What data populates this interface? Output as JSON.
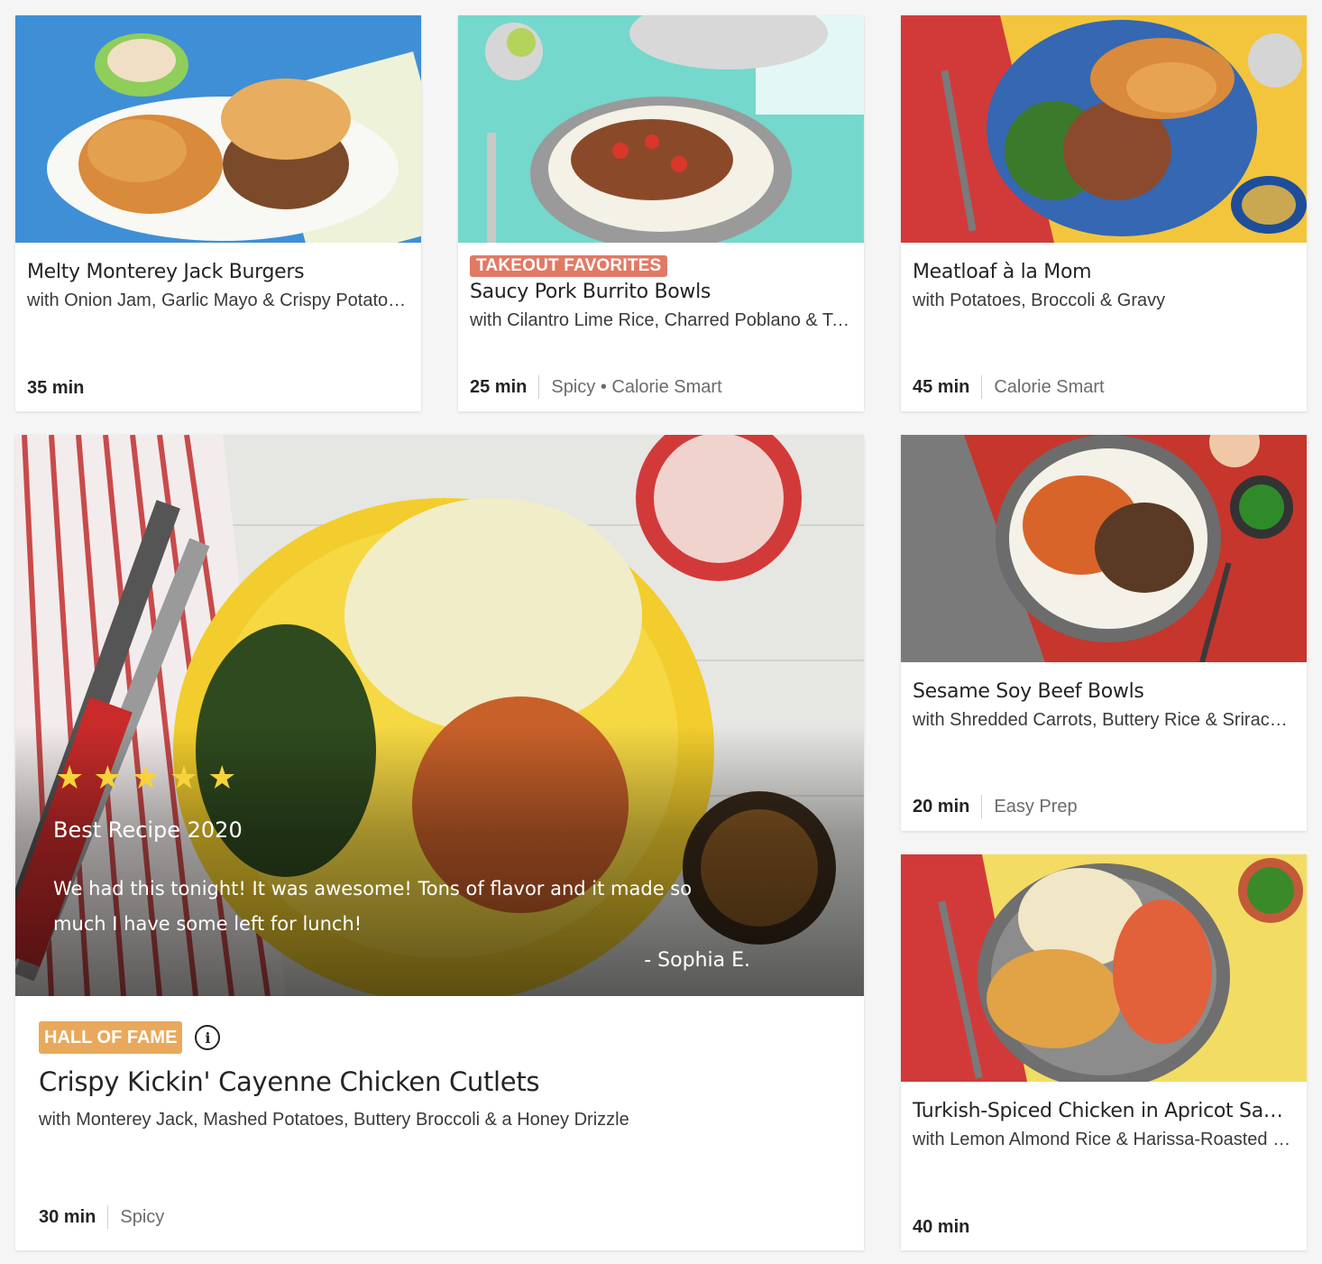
{
  "cards": {
    "burgers": {
      "title": "Melty Monterey Jack Burgers",
      "subtitle": "with Onion Jam, Garlic Mayo & Crispy Potato Wedges",
      "time": "35 min"
    },
    "burrito": {
      "badge": "TAKEOUT FAVORITES",
      "title": "Saucy Pork Burrito Bowls",
      "subtitle": "with Cilantro Lime Rice, Charred Poblano & Tomato Salsa",
      "time": "25 min",
      "tags": "Spicy • Calorie Smart"
    },
    "meatloaf": {
      "title": "Meatloaf à la Mom",
      "subtitle": "with Potatoes, Broccoli & Gravy",
      "time": "45 min",
      "tags": "Calorie Smart"
    },
    "beefbowls": {
      "title": "Sesame Soy Beef Bowls",
      "subtitle": "with Shredded Carrots, Buttery Rice & Sriracha Mayo",
      "time": "20 min",
      "tags": "Easy Prep"
    },
    "turkish": {
      "title": "Turkish-Spiced Chicken in Apricot Sauce",
      "subtitle": "with Lemon Almond Rice & Harissa-Roasted Carrots",
      "time": "40 min"
    },
    "feature": {
      "rating": 5,
      "quote_heading": "Best Recipe 2020",
      "quote": "We had this tonight! It was awesome! Tons of flavor and it made so much I have some left for lunch!",
      "author": "- Sophia E.",
      "badge": "HALL OF FAME",
      "title": "Crispy Kickin' Cayenne Chicken Cutlets",
      "subtitle": "with Monterey Jack, Mashed Potatoes, Buttery Broccoli & a Honey Drizzle",
      "time": "30 min",
      "tags": "Spicy"
    }
  },
  "colors": {
    "takeout_badge": "#e07a65",
    "hall_of_fame_badge": "#e9a95c",
    "star": "#f7d23b"
  },
  "icons": {
    "star": "star-icon",
    "info": "info-icon"
  }
}
